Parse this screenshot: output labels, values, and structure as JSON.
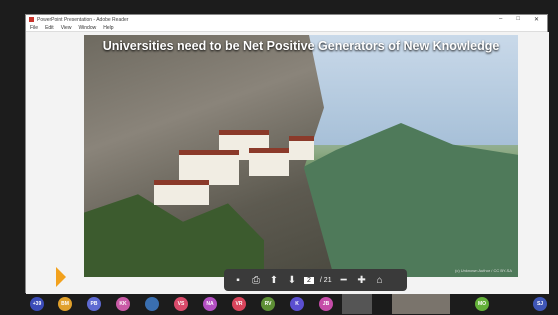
{
  "window": {
    "title": "PowerPoint Presentation - Adobe Reader",
    "controls": [
      "–",
      "□",
      "✕"
    ]
  },
  "menu": [
    "File",
    "Edit",
    "View",
    "Window",
    "Help"
  ],
  "slide": {
    "title": "Universities need to be Net Positive Generators of New Knowledge",
    "credit": "(c) Unknown Author / CC BY-SA"
  },
  "pdf_toolbar": {
    "current_page": "2",
    "total_pages": "/ 21"
  },
  "participants": [
    {
      "initials": "+39",
      "color": "#3b4cb8"
    },
    {
      "initials": "BM",
      "color": "#e0a02b"
    },
    {
      "initials": "PB",
      "color": "#5e6ad2"
    },
    {
      "initials": "KK",
      "color": "#c95aa6"
    },
    {
      "initials": "",
      "color": "#3a6fb0"
    },
    {
      "initials": "VS",
      "color": "#d94a6a"
    },
    {
      "initials": "NA",
      "color": "#b34fc2"
    },
    {
      "initials": "VR",
      "color": "#d9445b"
    },
    {
      "initials": "RV",
      "color": "#5d8f35"
    },
    {
      "initials": "K",
      "color": "#5b4fd0"
    },
    {
      "initials": "JB",
      "color": "#c54ca8"
    },
    {
      "initials": "MO",
      "color": "#63b039"
    },
    {
      "initials": "SJ",
      "color": "#3f56b6"
    }
  ]
}
